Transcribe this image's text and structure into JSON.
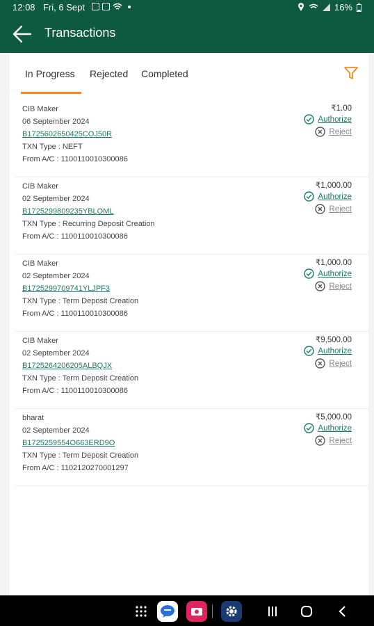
{
  "status_bar": {
    "time": "12:08",
    "date": "Fri, 6 Sept",
    "battery": "16%"
  },
  "app_bar": {
    "title": "Transactions"
  },
  "tabs": [
    {
      "label": "In Progress"
    },
    {
      "label": "Rejected"
    },
    {
      "label": "Completed"
    }
  ],
  "actions": {
    "authorize": "Authorize",
    "reject": "Reject"
  },
  "transactions": [
    {
      "maker": "CIB Maker",
      "date": "06 September 2024",
      "ref": "B1725602650425COJ50R",
      "txn_type": "TXN Type : NEFT",
      "from": "From A/C : 1100110010300086",
      "amount": "₹1.00"
    },
    {
      "maker": "CIB Maker",
      "date": "02 September 2024",
      "ref": "B1725299809235YBLOML",
      "txn_type": "TXN Type : Recurring Deposit Creation",
      "from": "From A/C : 1100110010300086",
      "amount": "₹1,000.00"
    },
    {
      "maker": "CIB Maker",
      "date": "02 September 2024",
      "ref": "B1725299709741YLJPF3",
      "txn_type": "TXN Type : Term Deposit Creation",
      "from": "From A/C : 1100110010300086",
      "amount": "₹1,000.00"
    },
    {
      "maker": "CIB Maker",
      "date": "02 September 2024",
      "ref": "B1725264206205ALBQJX",
      "txn_type": "TXN Type : Term Deposit Creation",
      "from": "From A/C : 1100110010300086",
      "amount": "₹9,500.00"
    },
    {
      "maker": "bharat",
      "date": "02 September 2024",
      "ref": "B1725259554O663ERD9O",
      "txn_type": "TXN Type : Term Deposit Creation",
      "from": "From A/C : 1102120270001297",
      "amount": "₹5,000.00"
    }
  ],
  "icons": {
    "back": "arrow-left-icon",
    "filter": "filter-icon",
    "authorize": "check-circle-icon",
    "reject": "x-circle-icon"
  },
  "colors": {
    "header": "#0e5a3f",
    "accent": "#f08a24",
    "link": "#1e7a5a"
  }
}
